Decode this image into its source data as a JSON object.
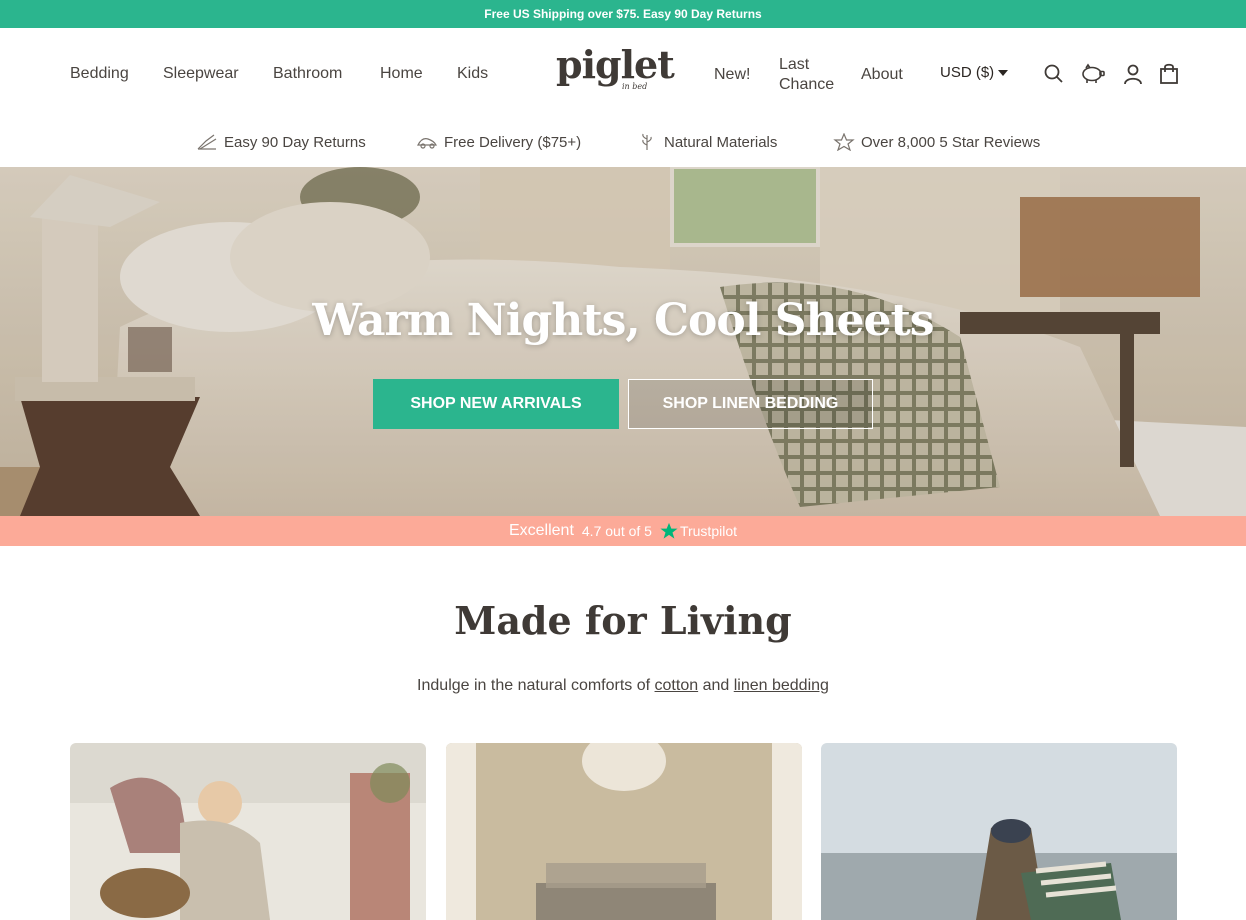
{
  "announcement": "Free US Shipping over $75. Easy 90 Day Returns",
  "header": {
    "nav_left": [
      "Bedding",
      "Sleepwear",
      "Bathroom",
      "Home",
      "Kids"
    ],
    "logo_text": "piglet",
    "logo_subtext": "in bed",
    "nav_right": [
      "New!",
      "Last",
      "Chance",
      "About"
    ],
    "currency": "USD ($)",
    "icons": [
      "search-icon",
      "pig-icon",
      "account-icon",
      "bag-icon"
    ]
  },
  "usps": [
    {
      "icon": "returns-icon",
      "label": "Easy 90 Day Returns"
    },
    {
      "icon": "delivery-icon",
      "label": "Free Delivery ($75+)"
    },
    {
      "icon": "plant-icon",
      "label": "Natural Materials"
    },
    {
      "icon": "star-icon",
      "label": "Over 8,000 5 Star Reviews"
    }
  ],
  "hero": {
    "title": "Warm Nights, Cool Sheets",
    "primary_button": "SHOP NEW ARRIVALS",
    "secondary_button": "SHOP LINEN BEDDING"
  },
  "trustpilot": {
    "rating_word": "Excellent",
    "score": "4.7 out of 5",
    "brand": "Trustpilot"
  },
  "section": {
    "title": "Made for Living",
    "subtitle_prefix": "Indulge in the natural comforts of",
    "link1": "cotton",
    "conjunction": "and",
    "link2": "linen bedding"
  },
  "colors": {
    "accent": "#2bb58e",
    "trust_bar": "#fcaa98",
    "text": "#3f3a36"
  }
}
